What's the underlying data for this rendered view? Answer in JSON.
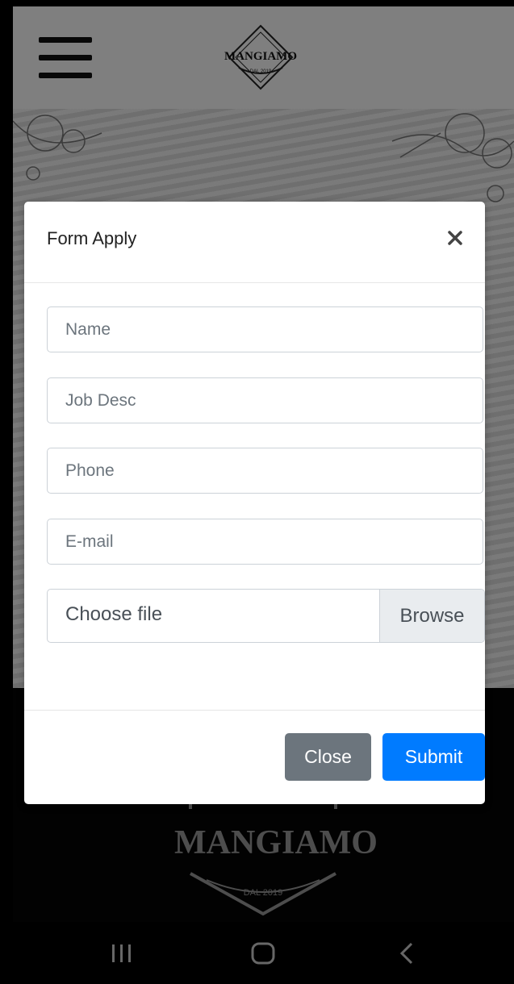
{
  "header": {
    "logo_text": "MANGIAMO",
    "logo_subtext": "DAL 2019"
  },
  "modal": {
    "title": "Form Apply",
    "close_icon": "close-icon",
    "fields": [
      {
        "placeholder": "Name"
      },
      {
        "placeholder": "Job Desc"
      },
      {
        "placeholder": "Phone"
      },
      {
        "placeholder": "E-mail"
      }
    ],
    "file": {
      "label": "Choose file",
      "browse": "Browse"
    },
    "footer": {
      "close_label": "Close",
      "submit_label": "Submit"
    }
  },
  "footer_logo": {
    "text": "MANGIAMO",
    "subtext": "DAL 2019"
  },
  "colors": {
    "primary": "#007bff",
    "secondary": "#6c757d",
    "backdrop": "rgba(0,0,0,0.5)"
  },
  "system_nav": {
    "recents_icon": "recents-icon",
    "home_icon": "home-icon",
    "back_icon": "back-icon"
  }
}
